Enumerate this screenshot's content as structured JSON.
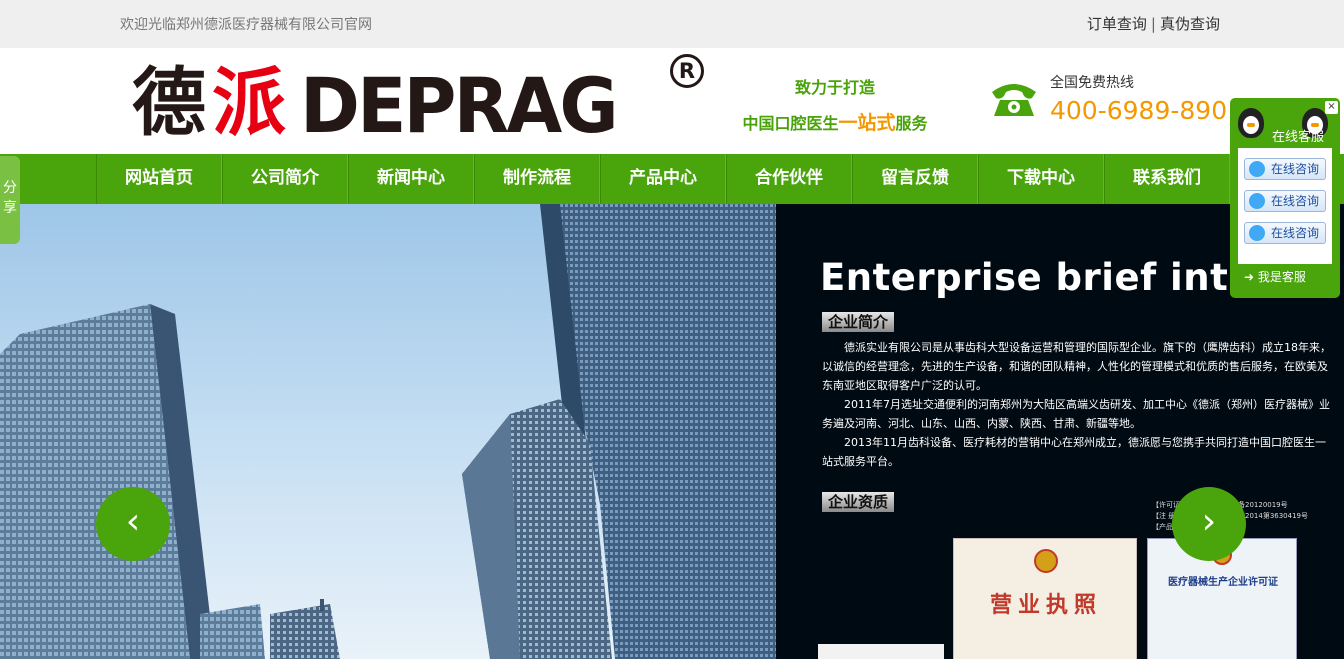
{
  "topbar": {
    "welcome": "欢迎光临郑州德派医疗器械有限公司官网",
    "order_query": "订单查询",
    "separator": "|",
    "authenticity_query": "真伪查询"
  },
  "header": {
    "logo_cn_1": "德",
    "logo_cn_2": "派",
    "logo_en": "DEPRAG",
    "logo_reg": "R",
    "slogan_line1": "致力于打造",
    "slogan_line2_a": "中国口腔医生",
    "slogan_line2_highlight": "一站式",
    "slogan_line2_b": "服务",
    "hotline_label": "全国免费热线",
    "hotline_number": "400-6989-890"
  },
  "nav": {
    "items": [
      {
        "label": "网站首页"
      },
      {
        "label": "公司简介"
      },
      {
        "label": "新闻中心"
      },
      {
        "label": "制作流程"
      },
      {
        "label": "产品中心"
      },
      {
        "label": "合作伙伴"
      },
      {
        "label": "留言反馈"
      },
      {
        "label": "下载中心"
      },
      {
        "label": "联系我们"
      }
    ]
  },
  "banner": {
    "title": "Enterprise brief introdu",
    "section1_tag": "企业简介",
    "para1": "德派实业有限公司是从事齿科大型设备运营和管理的国际型企业。旗下的（鹰牌齿科）成立18年来，以诚信的经营理念，先进的生产设备，和谐的团队精神，人性化的管理模式和优质的售后服务，在欧美及东南亚地区取得客户广泛的认可。",
    "para2": "2011年7月选址交通便利的河南郑州为大陆区高端义齿研发、加工中心《德派（郑州）医疗器械》业务遍及河南、河北、山东、山西、内蒙、陕西、甘肃、新疆等地。",
    "para3": "2013年11月齿科设备、医疗耗材的营销中心在郑州成立，德派愿与您携手共同打造中国口腔医生一站式服务平台。",
    "section2_tag": "企业资质",
    "license1_title": "营业执照",
    "license2_title": "医疗器械生产企业许可证",
    "mini_1": "【许可证",
    "mini_2": "【注 册",
    "mini_3": "【产品名",
    "mini_4": "备20120019号",
    "mini_5": "字2014第3630419号",
    "prev_arrow": "‹",
    "next_arrow": "›"
  },
  "share": {
    "label": "分享"
  },
  "kefu": {
    "title": "在线客服",
    "close": "×",
    "buttons": [
      {
        "label": "在线咨询"
      },
      {
        "label": "在线咨询"
      },
      {
        "label": "在线咨询"
      }
    ],
    "me": "我是客服"
  },
  "colors": {
    "brand_green": "#4aa40b",
    "accent_orange": "#f39800",
    "logo_red": "#e60012"
  }
}
